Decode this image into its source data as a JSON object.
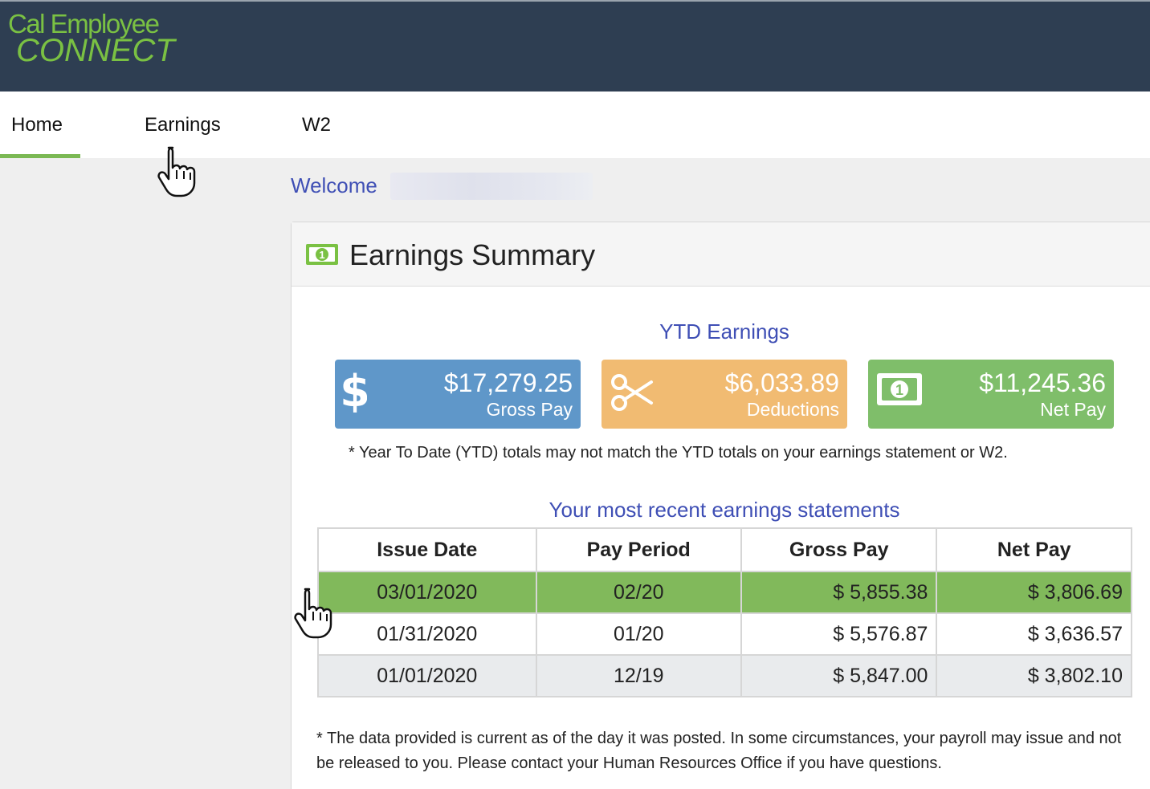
{
  "app": {
    "logo_line1": "Cal Employee",
    "logo_line2": "CONNECT"
  },
  "nav": {
    "tabs": [
      {
        "label": "Home",
        "active": true
      },
      {
        "label": "Earnings",
        "active": false
      },
      {
        "label": "W2",
        "active": false
      }
    ]
  },
  "welcome": {
    "label": "Welcome"
  },
  "summary": {
    "title": "Earnings Summary",
    "ytd_title": "YTD Earnings",
    "cards": [
      {
        "amount": "$17,279.25",
        "label": "Gross Pay",
        "icon": "dollar-sign-icon",
        "color": "#5f97c9"
      },
      {
        "amount": "$6,033.89",
        "label": "Deductions",
        "icon": "scissors-icon",
        "color": "#f1bb72"
      },
      {
        "amount": "$11,245.36",
        "label": "Net Pay",
        "icon": "money-bill-icon",
        "color": "#7fbe6a"
      }
    ],
    "ytd_note": "* Year To Date (YTD) totals may not match the YTD totals on your earnings statement or W2.",
    "recent_title": "Your most recent earnings statements",
    "table": {
      "headers": [
        "Issue Date",
        "Pay Period",
        "Gross Pay",
        "Net Pay"
      ],
      "rows": [
        {
          "issue_date": "03/01/2020",
          "pay_period": "02/20",
          "gross_pay": "$ 5,855.38",
          "net_pay": "$ 3,806.69"
        },
        {
          "issue_date": "01/31/2020",
          "pay_period": "01/20",
          "gross_pay": "$ 5,576.87",
          "net_pay": "$ 3,636.57"
        },
        {
          "issue_date": "01/01/2020",
          "pay_period": "12/19",
          "gross_pay": "$ 5,847.00",
          "net_pay": "$ 3,802.10"
        }
      ]
    },
    "footer_note": "* The data provided is current as of the day it was posted. In some circumstances, your payroll may issue and not be released to you. Please contact your Human Resources Office if you have questions."
  },
  "colors": {
    "header_bg": "#2e3e52",
    "brand_green": "#7ac143",
    "link_blue": "#3f4fb5",
    "highlight_row": "#81b95b"
  }
}
